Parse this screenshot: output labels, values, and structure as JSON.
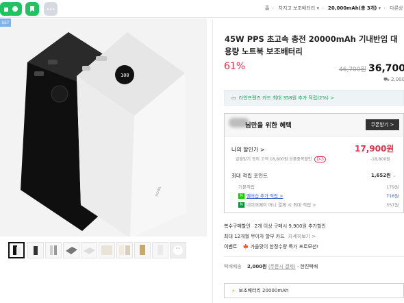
{
  "breadcrumb": {
    "home": "홈",
    "category": "차지고 보조배터리",
    "current": "20,000mAh(총 3개)",
    "other": "다른상"
  },
  "gallery": {
    "badge": "SET",
    "brand_on_product": "NOWL"
  },
  "product": {
    "title": "45W PPS 초고속 충전 20000mAh 기내반입 대용량 노트북 보조배터리",
    "discount": "61%",
    "original_price": "46,700원",
    "price": "36,700원",
    "shipping_note": "2,000원"
  },
  "card_banner": {
    "text": "라인프렌즈 카드 최대 358원 추가 적립(2%) >"
  },
  "benefit": {
    "title": "님만을 위한 혜택",
    "coupon_button": "쿠폰받기 >",
    "my_price_label": "나의 할인가 >",
    "my_price": "17,900원",
    "sub_line": "알림받기 등의 고객 18,800원 상품중복할인",
    "sub_badge": "D-3",
    "sub_value": "-18,800원",
    "points_label": "최대 적립 포인트",
    "points_total": "1,652원",
    "base_label": "기본적립",
    "base_value": "179원",
    "membership_label": "멤버십 추가 적립 >",
    "membership_value": "716원",
    "naverpay_label": "네이버페이 머니 결제 시 최대 적립 >",
    "naverpay_value": "357원"
  },
  "info": {
    "multi_label": "복수구매할인",
    "multi_text": "2개 이상 구매시 9,900원 추가할인",
    "install_text": "최대 12개월 무이자 할부 카드",
    "install_link": "자세히보기 >",
    "event_label": "이벤트",
    "event_text": "가을맞이 한정수량 특가 프로모션!",
    "shipping_label": "택배배송",
    "shipping_price": "2,000원",
    "shipping_pay": "(주문시 결제)",
    "shipping_carrier": "· 한진택배"
  },
  "option": {
    "label": "보조배터리 20000mAh"
  },
  "colors": {
    "accent_red": "#e0334b",
    "green": "#1a9b57",
    "app_green": "#1ec800"
  }
}
